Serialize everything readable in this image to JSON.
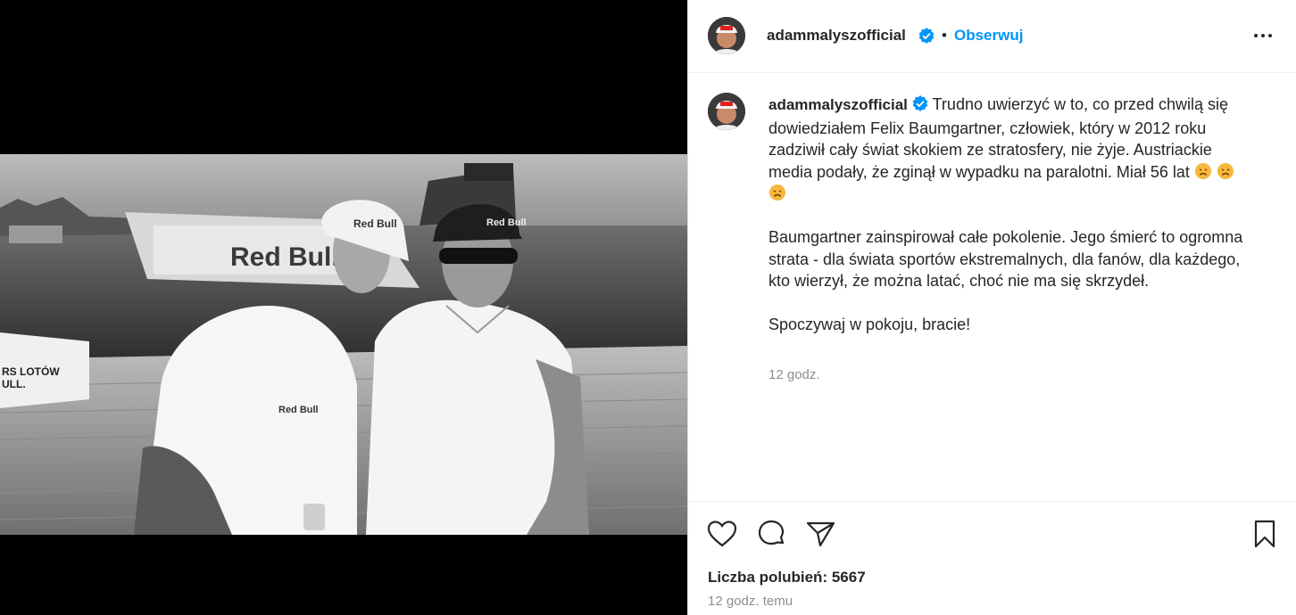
{
  "post": {
    "username": "adammalyszofficial",
    "follow_label": "Obserwuj",
    "dot": "•",
    "caption_p1": "Trudno uwierzyć w to, co przed chwilą się dowiedziałem Felix Baumgartner, człowiek, który w 2012 roku zadziwił cały świat skokiem ze stratosfery, nie żyje. Austriackie media podały, że zginął w wypadku na paralotni. Miał 56 lat",
    "caption_p2": "Baumgartner zainspirował całe pokolenie. Jego śmierć to ogromna strata - dla świata sportów ekstremalnych, dla fanów, dla każdego, kto wierzył, że można latać, choć nie ma się skrzydeł.",
    "caption_p3": "Spoczywaj w pokoju, bracie!",
    "caption_time": "12 godz.",
    "likes_label": "Liczba polubień: 5667",
    "time_ago": "12 godz. temu",
    "emojis": [
      "sad-face-emoji",
      "sad-face-emoji",
      "sad-face-emoji"
    ]
  },
  "photo": {
    "banner_text": "Red Bull",
    "cap_text_left": "Red Bull",
    "cap_text_right": "Red Bull",
    "shirt_logo": "Red Bull",
    "side_text": "RS LOTÓW\nULL."
  },
  "colors": {
    "accent": "#0095f6",
    "text": "#262626",
    "muted": "#8e8e8e",
    "verified": "#0095f6"
  },
  "icons": [
    "verified-badge-icon",
    "more-options-icon",
    "heart-icon",
    "comment-icon",
    "share-icon",
    "bookmark-icon"
  ]
}
